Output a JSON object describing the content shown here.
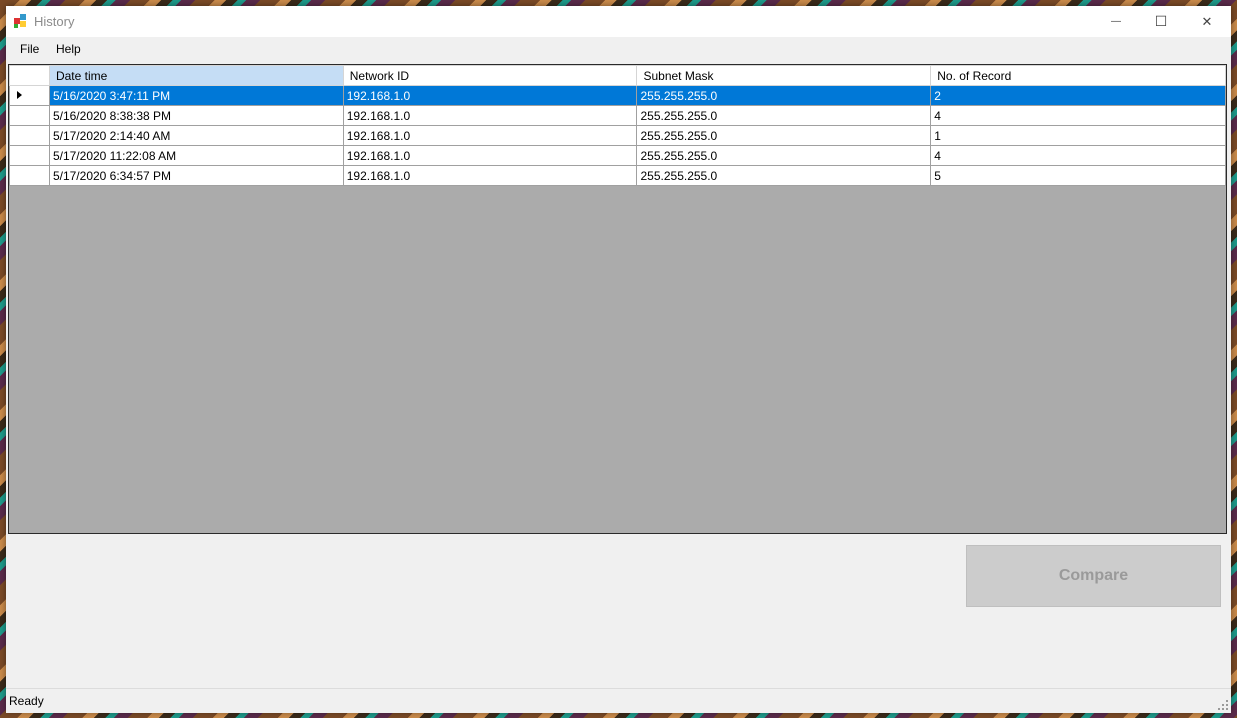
{
  "window": {
    "title": "History",
    "minimize_glyph": "—",
    "maximize_glyph": "☐",
    "close_glyph": "✕"
  },
  "menu": {
    "items": [
      {
        "label": "File"
      },
      {
        "label": "Help"
      }
    ]
  },
  "grid": {
    "columns": [
      "Date time",
      "Network ID",
      "Subnet Mask",
      "No. of Record"
    ],
    "rows": [
      {
        "date_time": "5/16/2020 3:47:11 PM",
        "network_id": "192.168.1.0",
        "subnet_mask": "255.255.255.0",
        "records": "2"
      },
      {
        "date_time": "5/16/2020 8:38:38 PM",
        "network_id": "192.168.1.0",
        "subnet_mask": "255.255.255.0",
        "records": "4"
      },
      {
        "date_time": "5/17/2020 2:14:40 AM",
        "network_id": "192.168.1.0",
        "subnet_mask": "255.255.255.0",
        "records": "1"
      },
      {
        "date_time": "5/17/2020 11:22:08 AM",
        "network_id": "192.168.1.0",
        "subnet_mask": "255.255.255.0",
        "records": "4"
      },
      {
        "date_time": "5/17/2020 6:34:57 PM",
        "network_id": "192.168.1.0",
        "subnet_mask": "255.255.255.0",
        "records": "5"
      }
    ]
  },
  "actions": {
    "compare_label": "Compare"
  },
  "status": {
    "text": "Ready"
  },
  "colors": {
    "selection": "#0078d7",
    "sorted_header": "#c5ddf5",
    "grid_background": "#ababab"
  }
}
